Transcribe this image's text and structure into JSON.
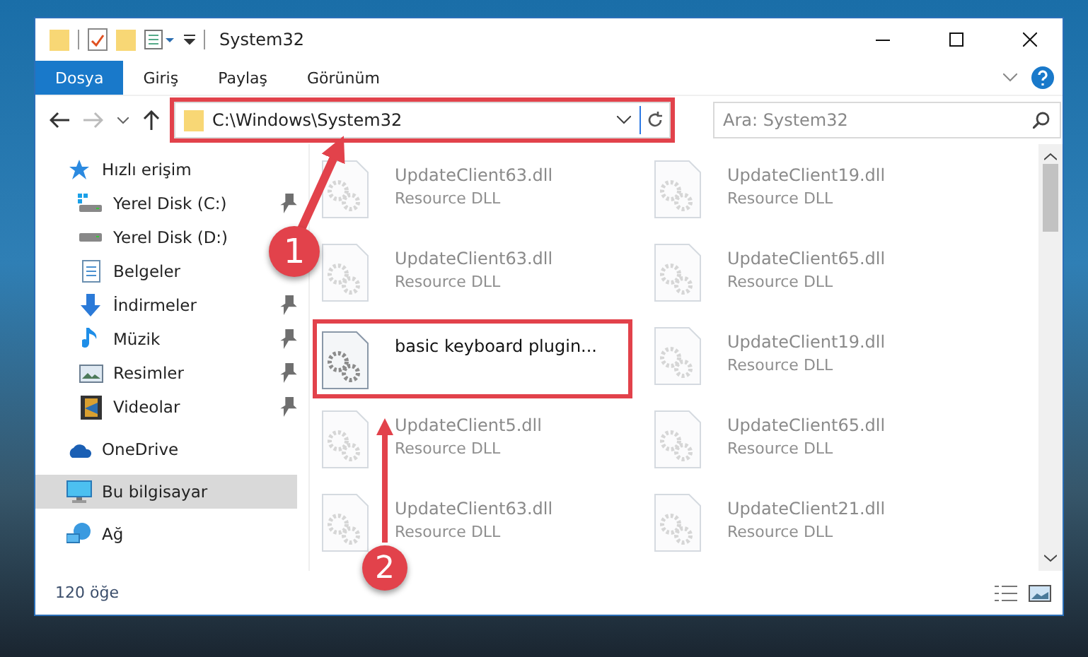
{
  "window": {
    "title": "System32"
  },
  "ribbon": {
    "tabs": [
      {
        "label": "Dosya",
        "selected": true
      },
      {
        "label": "Giriş",
        "selected": false
      },
      {
        "label": "Paylaş",
        "selected": false
      },
      {
        "label": "Görünüm",
        "selected": false
      }
    ]
  },
  "address_bar": {
    "path": "C:\\Windows\\System32",
    "highlighted": true,
    "callout": "1"
  },
  "search": {
    "placeholder": "Ara: System32"
  },
  "sidebar": {
    "items": [
      {
        "label": "Hızlı erişim",
        "kind": "star",
        "selected": false,
        "children": [
          {
            "label": "Yerel Disk (C:)",
            "kind": "windrive",
            "pinned": true,
            "selected": false
          },
          {
            "label": "Yerel Disk (D:)",
            "kind": "drive",
            "pinned": false,
            "selected": false
          },
          {
            "label": "Belgeler",
            "kind": "documents",
            "pinned": false,
            "selected": false
          },
          {
            "label": "İndirmeler",
            "kind": "download",
            "pinned": true,
            "selected": false
          },
          {
            "label": "Müzik",
            "kind": "music",
            "pinned": true,
            "selected": false
          },
          {
            "label": "Resimler",
            "kind": "pictures",
            "pinned": true,
            "selected": false
          },
          {
            "label": "Videolar",
            "kind": "videos",
            "pinned": true,
            "selected": false
          }
        ]
      },
      {
        "label": "OneDrive",
        "kind": "cloud",
        "selected": false
      },
      {
        "label": "Bu bilgisayar",
        "kind": "computer",
        "selected": true
      },
      {
        "label": "Ağ",
        "kind": "network",
        "selected": false
      }
    ]
  },
  "files": [
    {
      "name": "UpdateClient63.dll",
      "type": "Resource DLL",
      "highlighted": false
    },
    {
      "name": "UpdateClient19.dll",
      "type": "Resource DLL",
      "highlighted": false
    },
    {
      "name": "UpdateClient63.dll",
      "type": "Resource DLL",
      "highlighted": false
    },
    {
      "name": "UpdateClient65.dll",
      "type": "Resource DLL",
      "highlighted": false
    },
    {
      "name": "basic keyboard plugin...",
      "highlighted": true,
      "callout": "2"
    },
    {
      "name": "UpdateClient19.dll",
      "type": "Resource DLL",
      "highlighted": false
    },
    {
      "name": "UpdateClient5.dll",
      "type": "Resource DLL",
      "highlighted": false
    },
    {
      "name": "UpdateClient65.dll",
      "type": "Resource DLL",
      "highlighted": false
    },
    {
      "name": "UpdateClient63.dll",
      "type": "Resource DLL",
      "highlighted": false
    },
    {
      "name": "UpdateClient21.dll",
      "type": "Resource DLL",
      "highlighted": false
    }
  ],
  "status_bar": {
    "count": "120 öğe"
  }
}
